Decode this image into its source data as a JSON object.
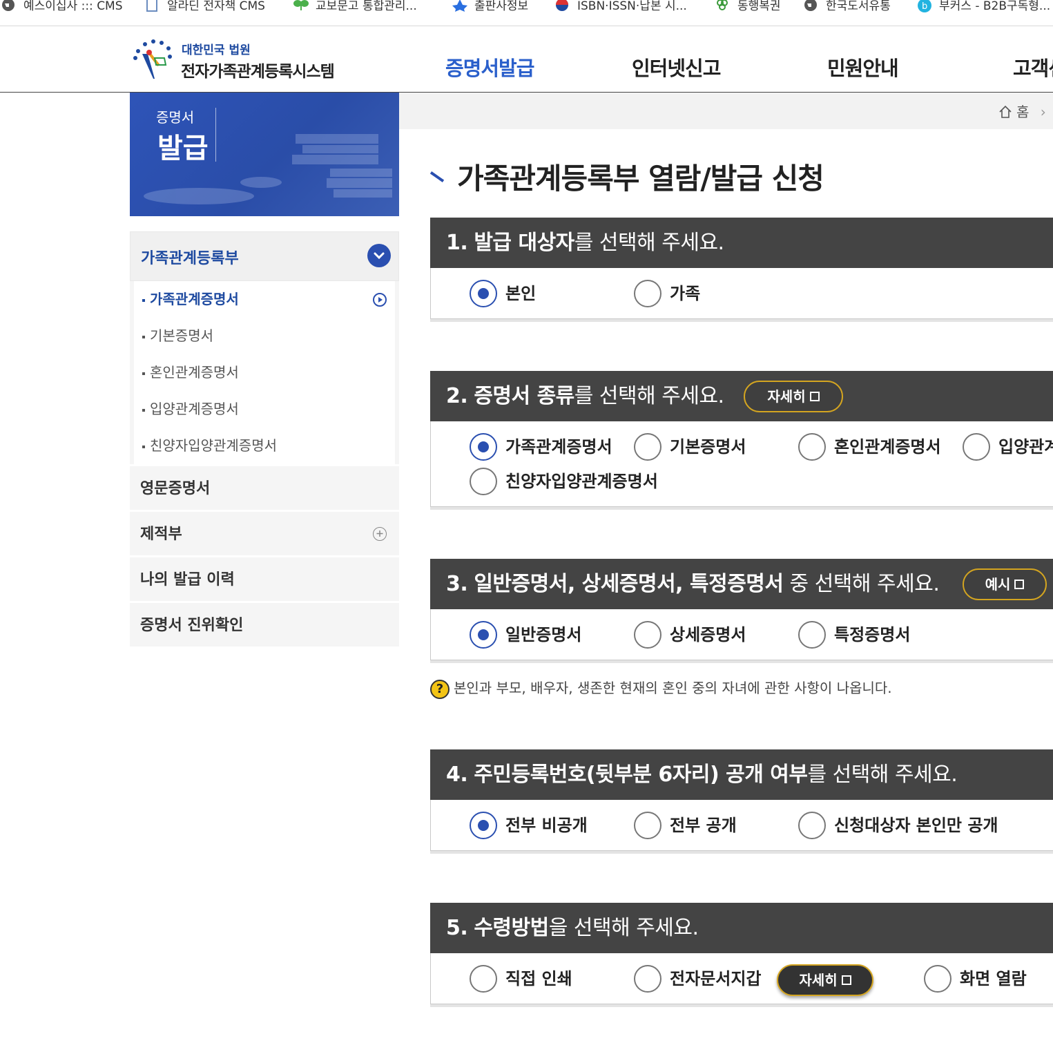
{
  "bookmarks": [
    {
      "label": "예스이십사 ::: CMS",
      "icon": "globe-icon"
    },
    {
      "label": "알라딘 전자책 CMS",
      "icon": "document-icon"
    },
    {
      "label": "교보문고 통합관리...",
      "icon": "leaf-icon"
    },
    {
      "label": "출판사정보",
      "icon": "star-icon"
    },
    {
      "label": "ISBN·ISSN·납본 시...",
      "icon": "taegeuk-icon"
    },
    {
      "label": "동행복권",
      "icon": "clover-icon"
    },
    {
      "label": "한국도서유통",
      "icon": "globe-icon"
    },
    {
      "label": "부커스 - B2B구독형...",
      "icon": "b-circle-icon"
    }
  ],
  "header": {
    "logo_small": "대한민국 법원",
    "logo_big": "전자가족관계등록시스템",
    "nav": [
      "증명서발급",
      "인터넷신고",
      "민원안내",
      "고객센터"
    ],
    "active_nav": "증명서발급"
  },
  "banner": {
    "line1": "증명서",
    "line2": "발급"
  },
  "sidebar": {
    "section_label": "가족관계등록부",
    "sub_items": [
      "가족관계증명서",
      "기본증명서",
      "혼인관계증명서",
      "입양관계증명서",
      "친양자입양관계증명서"
    ],
    "active_sub": "가족관계증명서",
    "rows": [
      "영문증명서",
      "제적부",
      "나의 발급 이력",
      "증명서 진위확인"
    ]
  },
  "breadcrumb": {
    "home": "홈"
  },
  "page_title": "가족관계등록부 열람/발급 신청",
  "steps": {
    "s1": {
      "num": "1.",
      "bold": "발급 대상자",
      "rest": "를 선택해 주세요.",
      "options": [
        "본인",
        "가족"
      ],
      "selected": "본인"
    },
    "s2": {
      "num": "2.",
      "bold": "증명서 종류",
      "rest": "를 선택해 주세요.",
      "button": "자세히",
      "options": [
        "가족관계증명서",
        "기본증명서",
        "혼인관계증명서",
        "입양관계증명서",
        "친양자입양관계증명서"
      ],
      "selected": "가족관계증명서"
    },
    "s3": {
      "num": "3.",
      "bold": "일반증명서, 상세증명서, 특정증명서",
      "rest": " 중 선택해 주세요.",
      "button": "예시",
      "options": [
        "일반증명서",
        "상세증명서",
        "특정증명서"
      ],
      "selected": "일반증명서"
    },
    "s4": {
      "num": "4.",
      "bold": "주민등록번호(뒷부분 6자리) 공개 여부",
      "rest": "를 선택해 주세요.",
      "options": [
        "전부 비공개",
        "전부 공개",
        "신청대상자 본인만 공개"
      ],
      "selected": "전부 비공개"
    },
    "s5": {
      "num": "5.",
      "bold": "수령방법",
      "rest": "을 선택해 주세요.",
      "button": "자세히",
      "options": [
        "직접 인쇄",
        "전자문서지갑",
        "화면 열람"
      ],
      "selected": ""
    }
  },
  "help_text": "본인과 부모, 배우자, 생존한 현재의 혼인 중의 자녀에 관한 사항이 나옵니다.",
  "colors": {
    "accent": "#2a5fcb",
    "bar": "#444444",
    "pill_border": "#d4a520"
  }
}
